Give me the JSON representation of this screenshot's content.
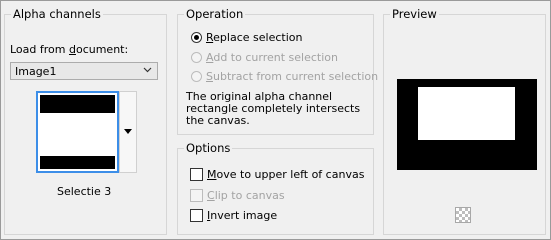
{
  "alpha_channels": {
    "title": "Alpha channels",
    "load_label_pre": "Load from ",
    "load_label_u": "d",
    "load_label_post": "ocument:",
    "document_value": "Image1",
    "selection_name": "Selectie 3"
  },
  "operation": {
    "title": "Operation",
    "options": [
      {
        "u": "R",
        "rest": "eplace selection",
        "selected": true,
        "enabled": true
      },
      {
        "u": "A",
        "rest": "dd to current selection",
        "selected": false,
        "enabled": false
      },
      {
        "u": "S",
        "rest": "ubtract from current selection",
        "selected": false,
        "enabled": false
      }
    ],
    "message": "The original alpha channel rectangle completely intersects the canvas."
  },
  "options": {
    "title": "Options",
    "items": [
      {
        "u": "M",
        "rest": "ove to upper left of canvas",
        "checked": false,
        "enabled": true
      },
      {
        "u": "C",
        "rest": "lip to canvas",
        "checked": false,
        "enabled": false
      },
      {
        "u": "I",
        "rest": "nvert image",
        "checked": false,
        "enabled": true
      }
    ]
  },
  "preview": {
    "title": "Preview",
    "zoom_icon": "checkerboard-zoom-icon"
  }
}
